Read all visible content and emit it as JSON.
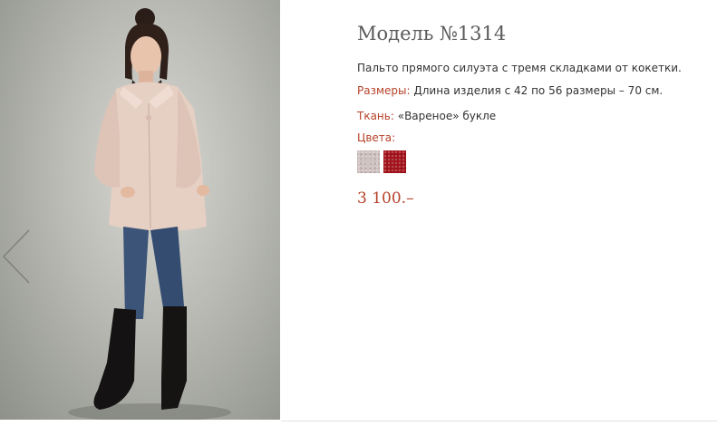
{
  "product": {
    "title": "Модель №1314",
    "description": "Пальто прямого силуэта с тремя складками  от кокетки.",
    "sizes": {
      "label": "Размеры:",
      "value": "Длина изделия с 42 по 56 размеры – 70 см."
    },
    "fabric": {
      "label": "Ткань:",
      "value": "«Вареное» букле"
    },
    "colors": {
      "label": "Цвета:",
      "swatches": [
        {
          "name": "beige-boucle",
          "color": "#cfc1c0"
        },
        {
          "name": "red-boucle",
          "color": "#a5111a"
        }
      ]
    },
    "price": "3 100.–"
  },
  "theme": {
    "accent": "#b7422a",
    "title_color": "#5a5a5a",
    "text_color": "#333333",
    "price_color": "#b7422a"
  }
}
